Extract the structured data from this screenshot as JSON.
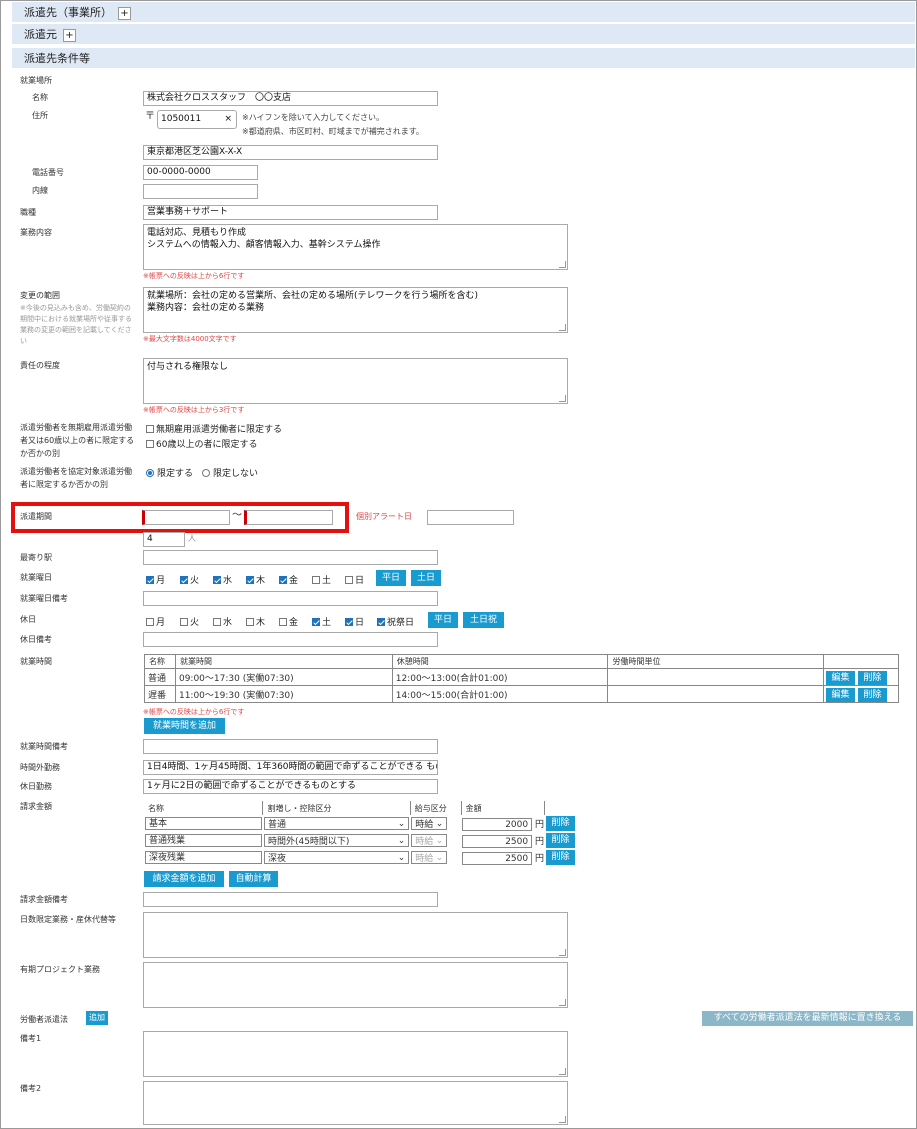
{
  "sections": {
    "dispatch_office": "派遣先（事業所）",
    "dispatch_source": "派遣元",
    "dispatch_conditions": "派遣先条件等",
    "expand_symbol": "+"
  },
  "workplace": {
    "heading": "就業場所",
    "name_label": "名称",
    "name_value": "株式会社クロススタッフ　〇〇支店",
    "address_label": "住所",
    "postal_mark": "〒",
    "postal_value": "1050011",
    "clear_symbol": "×",
    "postal_note1": "※ハイフンを除いて入力してください。",
    "postal_note2": "※都道府県、市区町村、町域までが補完されます。",
    "address_value": "東京都港区芝公園X-X-X",
    "phone_label": "電話番号",
    "phone_value": "00-0000-0000",
    "extension_label": "内線",
    "extension_value": ""
  },
  "job_type": {
    "label": "職種",
    "value": "営業事務＋サポート"
  },
  "job_content": {
    "label": "業務内容",
    "value": "電話対応、見積もり作成\nシステムへの情報入力、顧客情報入力、基幹システム操作",
    "hint": "※帳票への反映は上から6行です"
  },
  "change_scope": {
    "label": "変更の範囲",
    "note": "※今後の見込みも含め、労働契約の期間中における就業場所や従事する業務の変更の範囲を記載してください",
    "value": "就業場所：会社の定める営業所、会社の定める場所(テレワークを行う場所を含む)\n業務内容：会社の定める業務",
    "hint": "※最大文字数は4000文字です"
  },
  "responsibility": {
    "label": "責任の程度",
    "value": "付与される権限なし",
    "hint": "※帳票への反映は上から3行です"
  },
  "indefinite_limit": {
    "label": "派遣労働者を無期雇用派遣労働者又は60歳以上の者に限定するか否かの別",
    "option1": "無期雇用派遣労働者に限定する",
    "option2": "60歳以上の者に限定する"
  },
  "agreement_limit": {
    "label": "派遣労働者を協定対象派遣労働者に限定するか否かの別",
    "option_yes": "限定する",
    "option_no": "限定しない"
  },
  "period": {
    "label": "派遣期間",
    "separator": "〜",
    "alert_label": "個別アラート日",
    "start": "",
    "end": "",
    "alert_value": ""
  },
  "headcount": {
    "label": "派遣人数",
    "value": "4",
    "unit": "人"
  },
  "nearest_station": {
    "label": "最寄り駅",
    "value": ""
  },
  "work_days": {
    "label": "就業曜日",
    "days": [
      {
        "label": "月",
        "checked": true
      },
      {
        "label": "火",
        "checked": true
      },
      {
        "label": "水",
        "checked": true
      },
      {
        "label": "木",
        "checked": true
      },
      {
        "label": "金",
        "checked": true
      },
      {
        "label": "土",
        "checked": false
      },
      {
        "label": "日",
        "checked": false
      }
    ],
    "weekday_button": "平日",
    "weekend_button": "土日"
  },
  "work_days_note": {
    "label": "就業曜日備考",
    "value": ""
  },
  "holidays": {
    "label": "休日",
    "days": [
      {
        "label": "月",
        "checked": false
      },
      {
        "label": "火",
        "checked": false
      },
      {
        "label": "水",
        "checked": false
      },
      {
        "label": "木",
        "checked": false
      },
      {
        "label": "金",
        "checked": false
      },
      {
        "label": "土",
        "checked": true
      },
      {
        "label": "日",
        "checked": true
      },
      {
        "label": "祝祭日",
        "checked": true
      }
    ],
    "weekday_button": "平日",
    "weekend_button": "土日祝"
  },
  "holidays_note": {
    "label": "休日備考",
    "value": ""
  },
  "work_hours": {
    "label": "就業時間",
    "headers": [
      "名称",
      "就業時間",
      "休憩時間",
      "労働時間単位"
    ],
    "rows": [
      {
        "name": "普通",
        "hours": "09:00〜17:30 (実働07:30)",
        "break": "12:00〜13:00(合計01:00)",
        "unit": ""
      },
      {
        "name": "遅番",
        "hours": "11:00〜19:30 (実働07:30)",
        "break": "14:00〜15:00(合計01:00)",
        "unit": ""
      }
    ],
    "edit_button": "編集",
    "delete_button": "削除",
    "hint": "※帳票への反映は上から6行です",
    "add_button": "就業時間を追加"
  },
  "work_hours_note": {
    "label": "就業時間備考",
    "value": ""
  },
  "overtime": {
    "label": "時間外勤務",
    "value": "1日4時間、1ヶ月45時間、1年360時間の範囲で命ずることができる もの"
  },
  "holiday_work": {
    "label": "休日勤務",
    "value": "1ヶ月に2日の範囲で命ずることができるものとする"
  },
  "billing": {
    "label": "請求金額",
    "headers": [
      "名称",
      "割増し・控除区分",
      "給与区分",
      "金額"
    ],
    "rows": [
      {
        "name": "基本",
        "category": "普通",
        "pay_type": "時給",
        "pay_disabled": false,
        "amount": "2000",
        "unit": "円"
      },
      {
        "name": "普通残業",
        "category": "時間外(45時間以下)",
        "pay_type": "時給",
        "pay_disabled": true,
        "amount": "2500",
        "unit": "円"
      },
      {
        "name": "深夜残業",
        "category": "深夜",
        "pay_type": "時給",
        "pay_disabled": true,
        "amount": "2500",
        "unit": "円"
      }
    ],
    "delete_button": "削除",
    "add_button": "請求金額を追加",
    "auto_button": "自動計算"
  },
  "billing_note": {
    "label": "請求金額備考",
    "value": ""
  },
  "limited_days": {
    "label": "日数限定業務・産休代替等",
    "value": ""
  },
  "fixed_project": {
    "label": "有期プロジェクト業務",
    "value": ""
  },
  "dispatch_law": {
    "label": "労働者派遣法",
    "add_button": "追加",
    "replace_button": "すべての労働者派遣法を最新情報に置き換える"
  },
  "remarks1": {
    "label": "備考1",
    "value": ""
  },
  "remarks2": {
    "label": "備考2",
    "value": ""
  },
  "colors": {
    "accent": "#1a9bd0",
    "section_bg": "#dfe8f5",
    "hint": "#e04444",
    "highlight": "#e41010"
  }
}
